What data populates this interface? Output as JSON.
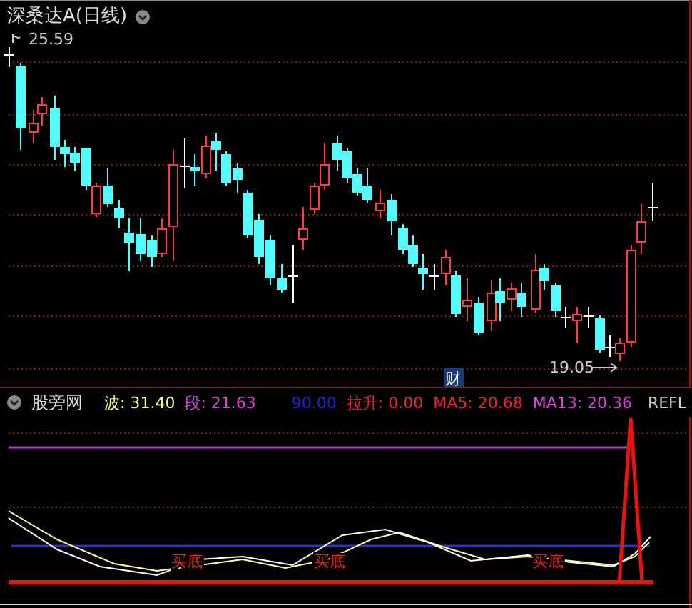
{
  "chart_title": {
    "text": "深桑达A(日线)"
  },
  "price_chart": {
    "high_label": "25.59",
    "low_label": "19.05",
    "badge": "财"
  },
  "indicator": {
    "name": "股旁网",
    "values": [
      {
        "text": "波: 31.40",
        "color": "#ffff66"
      },
      {
        "text": "段: 21.63",
        "color": "#dd44dd"
      },
      {
        "text": "90.00",
        "color": "#2222cc"
      },
      {
        "text": "拉升: 0.00",
        "color": "#ee2222"
      },
      {
        "text": "MA5: 20.68",
        "color": "#ee2222"
      },
      {
        "text": "MA13: 20.36",
        "color": "#dd44dd"
      },
      {
        "text": "REFL",
        "color": "#cccccc"
      }
    ],
    "signals": [
      "买底",
      "买底",
      "买底"
    ]
  }
}
